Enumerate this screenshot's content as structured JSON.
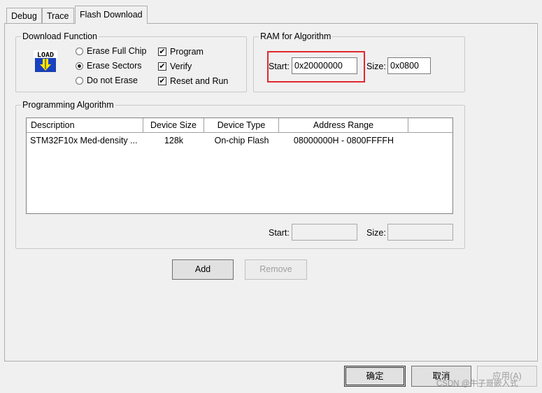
{
  "tabs": [
    {
      "label": "Debug"
    },
    {
      "label": "Trace"
    },
    {
      "label": "Flash Download"
    }
  ],
  "download_function": {
    "legend": "Download Function",
    "icon_text": "LOAD",
    "erase_options": [
      {
        "label": "Erase Full Chip",
        "selected": false
      },
      {
        "label": "Erase Sectors",
        "selected": true
      },
      {
        "label": "Do not Erase",
        "selected": false
      }
    ],
    "checks": [
      {
        "label": "Program",
        "checked": true,
        "mark": "✔"
      },
      {
        "label": "Verify",
        "checked": true,
        "mark": "✔"
      },
      {
        "label": "Reset and Run",
        "checked": true,
        "mark": "✔"
      }
    ]
  },
  "ram": {
    "legend": "RAM for Algorithm",
    "start_label": "Start:",
    "start_value": "0x20000000",
    "size_label": "Size:",
    "size_value": "0x0800",
    "highlight_color": "#e0282e"
  },
  "programming": {
    "legend": "Programming Algorithm",
    "columns": [
      "Description",
      "Device Size",
      "Device Type",
      "Address Range"
    ],
    "rows": [
      [
        "STM32F10x Med-density ...",
        "128k",
        "On-chip Flash",
        "08000000H - 0800FFFFH"
      ]
    ],
    "start_label": "Start:",
    "start_value": "",
    "size_label": "Size:",
    "size_value": ""
  },
  "actions": {
    "add": "Add",
    "remove": "Remove"
  },
  "dialog_buttons": {
    "ok": "确定",
    "cancel": "取消",
    "apply": "应用(A)"
  },
  "watermark": "CSDN @牛子哥嵌入式"
}
